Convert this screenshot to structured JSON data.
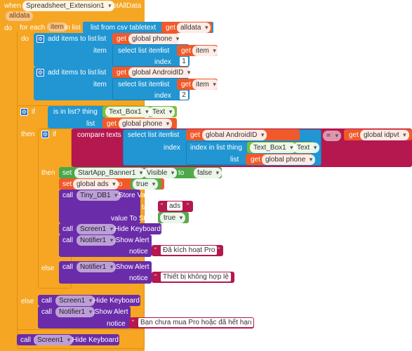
{
  "colors": {
    "event": "#f5a623",
    "control": "#f6a623",
    "list": "#2196d3",
    "variable": "#f05a2b",
    "component": "#6a2ca8",
    "text": "#b5174f",
    "logic": "#4aa84a",
    "setter": "#4aa84a",
    "green_prop": "#7cbf3b"
  },
  "event": {
    "when": "when",
    "component": "Spreadsheet_Extension1",
    "event_name": ".GotAllData",
    "param": "alldata",
    "do": "do"
  },
  "foreach": {
    "for_each": "for each",
    "var": "item",
    "in_list": "in list",
    "list_from_csv": "list from csv table",
    "text": "text",
    "get": "get",
    "get_var": "alldata",
    "do": "do"
  },
  "add1": {
    "label": "add items to list",
    "list": "list",
    "get": "get",
    "get_var": "global phone",
    "item": "item",
    "select": "select list item",
    "select_list": "list",
    "item_get": "get",
    "item_var": "item",
    "index": "index",
    "index_val": "1"
  },
  "add2": {
    "label": "add items to list",
    "list": "list",
    "get": "get",
    "get_var": "global AndroidID",
    "item": "item",
    "select": "select list item",
    "select_list": "list",
    "item_get": "get",
    "item_var": "item",
    "index": "index",
    "index_val": "2"
  },
  "if_outer": {
    "if": "if",
    "isinlist": "is in list?  thing",
    "thing_comp": "Text_Box1",
    "thing_prop": "Text",
    "list": "list",
    "get": "get",
    "get_var": "global phone",
    "then": "then",
    "else": "else"
  },
  "if_inner": {
    "if": "if",
    "compare": "compare texts",
    "select": "select list item",
    "list": "list",
    "get": "get",
    "get_var": "global AndroidID",
    "index": "index",
    "indexinlist": "index in list  thing",
    "thing_comp": "Text_Box1",
    "thing_prop": "Text",
    "list2": "list",
    "get2": "get",
    "get_var2": "global phone",
    "op": "=",
    "right_get": "get",
    "right_var": "global idpvt",
    "then": "then",
    "else": "else"
  },
  "then_inner": {
    "set1": "set",
    "set1_comp": "StartApp_Banner1",
    "set1_prop": "Visible",
    "to": "to",
    "false": "false",
    "set2": "set",
    "set2_var": "global ads",
    "to2": "to",
    "true": "true",
    "call": "call",
    "tinydb": "Tiny_DB1",
    "store": ".Store Value",
    "tag": "tag",
    "tag_val": "ads",
    "value_to_store": "value To Store",
    "store_true": "true",
    "screen": "Screen1",
    "hide": ".Hide Keyboard",
    "notifier": "Notifier1",
    "show_alert": ".Show Alert",
    "notice": "notice",
    "notice_val": "Đã kích hoạt Pro"
  },
  "else_inner": {
    "call": "call",
    "notifier": "Notifier1",
    "show_alert": ".Show Alert",
    "notice": "notice",
    "notice_val": "Thiết bị không hợp lệ"
  },
  "else_outer": {
    "call": "call",
    "screen": "Screen1",
    "hide": ".Hide Keyboard",
    "notifier": "Notifier1",
    "show_alert": ".Show Alert",
    "notice": "notice",
    "notice_val": "Bạn chưa mua Pro hoặc đã hết hạn"
  },
  "final": {
    "call": "call",
    "screen": "Screen1",
    "hide": ".Hide Keyboard"
  }
}
